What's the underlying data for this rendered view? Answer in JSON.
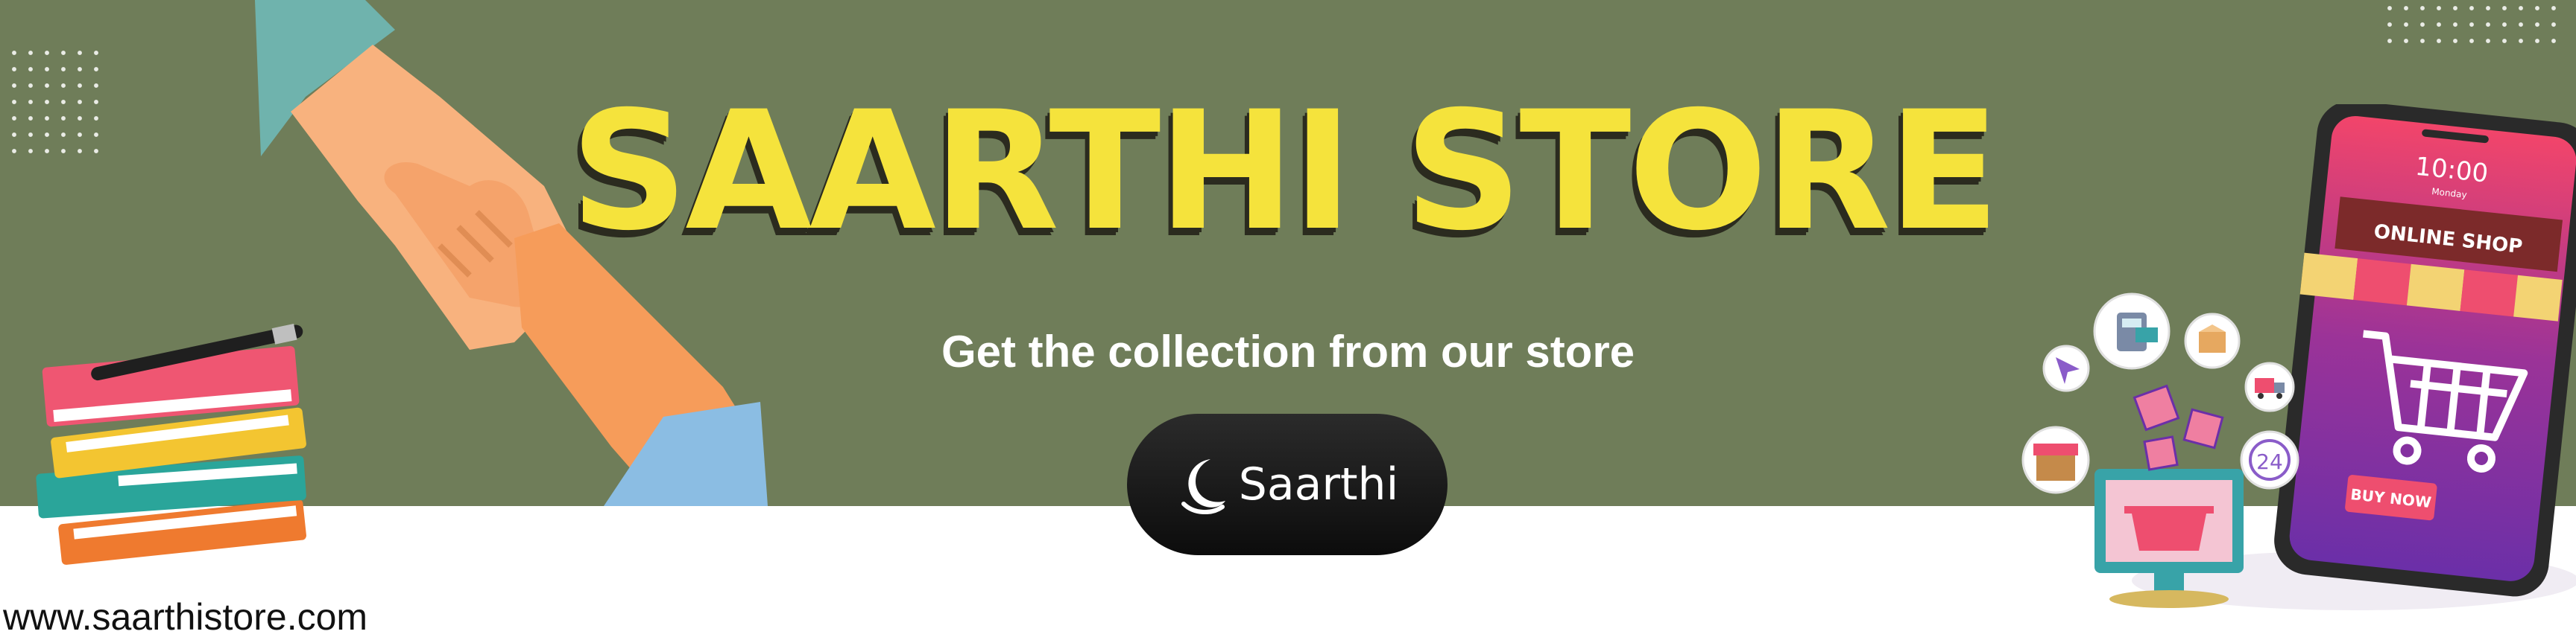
{
  "brand": {
    "title": "SAARTHI STORE",
    "subtitle": "Get the collection from our store",
    "logo_text": "Saarthi",
    "website": "www.saarthistore.com"
  },
  "phone": {
    "time": "10:00",
    "day": "Monday",
    "shop_sign": "ONLINE SHOP",
    "buy_button": "BUY NOW"
  },
  "badge_24": "24",
  "icons": [
    "handshake-illustration",
    "book-stack-illustration",
    "pen-icon",
    "moon-logo-icon",
    "smartphone-illustration",
    "shopping-cart-icon",
    "cursor-icon",
    "card-terminal-icon",
    "box-icon",
    "delivery-truck-icon",
    "gift-icon",
    "store-icon",
    "basket-icon",
    "24-hour-icon"
  ],
  "colors": {
    "banner_bg": "#6f7d59",
    "title_yellow": "#f5e33c",
    "title_shadow": "#2b2b1f",
    "pill_black": "#111111",
    "phone_pink": "#f2456a",
    "phone_purple": "#6b2fa8"
  }
}
